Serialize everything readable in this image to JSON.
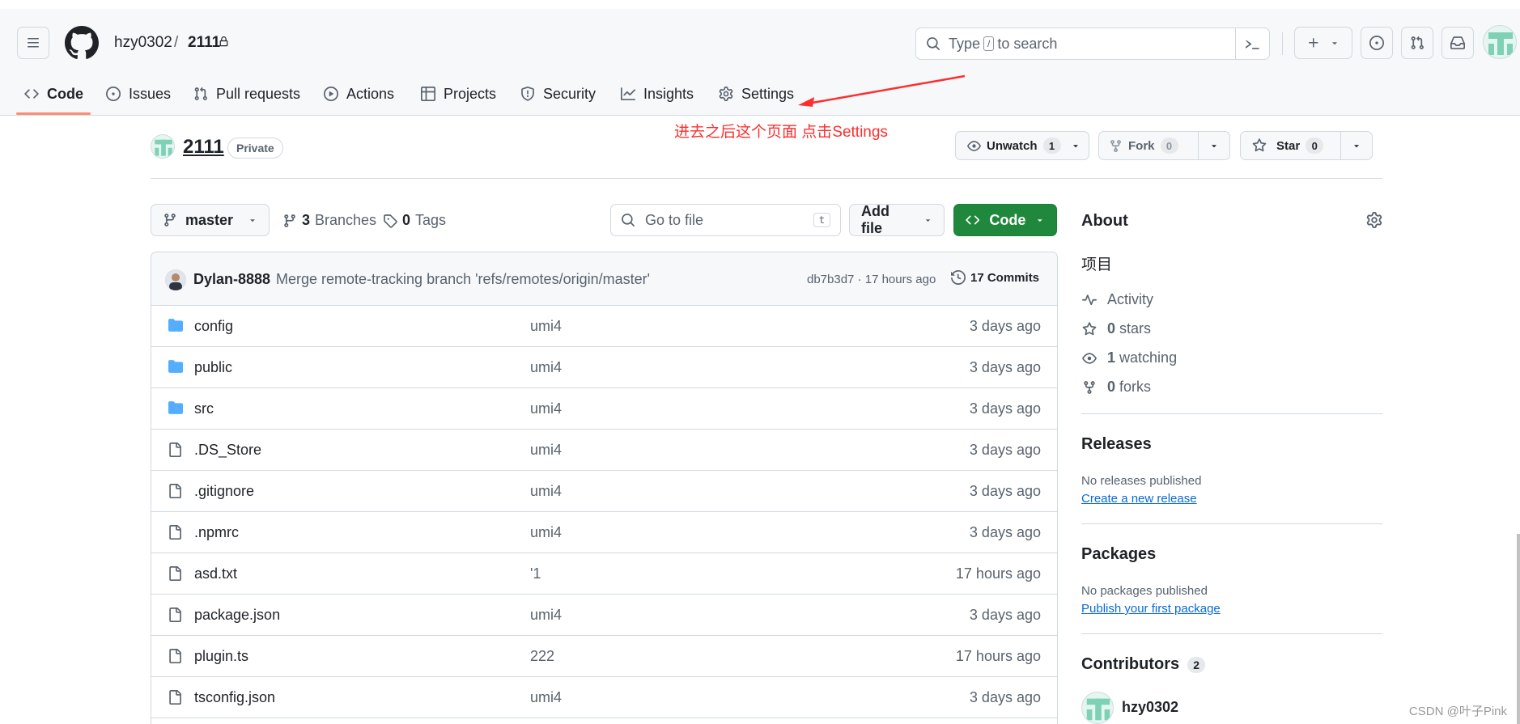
{
  "header": {
    "owner": "hzy0302",
    "separator": "/",
    "repo": "2111",
    "search_placeholder_pre": "Type",
    "search_key": "/",
    "search_placeholder_post": "to search"
  },
  "tabs": [
    {
      "label": "Code",
      "icon": "code-icon"
    },
    {
      "label": "Issues",
      "icon": "issue-icon"
    },
    {
      "label": "Pull requests",
      "icon": "pull-request-icon"
    },
    {
      "label": "Actions",
      "icon": "play-icon"
    },
    {
      "label": "Projects",
      "icon": "table-icon"
    },
    {
      "label": "Security",
      "icon": "shield-icon"
    },
    {
      "label": "Insights",
      "icon": "graph-icon"
    },
    {
      "label": "Settings",
      "icon": "gear-icon"
    }
  ],
  "annotation": "进去之后这个页面 点击Settings",
  "repo_head": {
    "name": "2111",
    "visibility": "Private",
    "unwatch_label": "Unwatch",
    "unwatch_count": "1",
    "fork_label": "Fork",
    "fork_count": "0",
    "star_label": "Star",
    "star_count": "0"
  },
  "toolbar": {
    "branch": "master",
    "branches_count": "3",
    "branches_label": "Branches",
    "tags_count": "0",
    "tags_label": "Tags",
    "goto_placeholder": "Go to file",
    "goto_key": "t",
    "add_file": "Add file",
    "code": "Code"
  },
  "latest_commit": {
    "author": "Dylan-8888",
    "message": "Merge remote-tracking branch 'refs/remotes/origin/master'",
    "sha_time": "db7b3d7 · 17 hours ago",
    "commits": "17 Commits"
  },
  "files": [
    {
      "name": "config",
      "type": "dir",
      "message": "umi4",
      "date": "3 days ago"
    },
    {
      "name": "public",
      "type": "dir",
      "message": "umi4",
      "date": "3 days ago"
    },
    {
      "name": "src",
      "type": "dir",
      "message": "umi4",
      "date": "3 days ago"
    },
    {
      "name": ".DS_Store",
      "type": "file",
      "message": "umi4",
      "date": "3 days ago"
    },
    {
      "name": ".gitignore",
      "type": "file",
      "message": "umi4",
      "date": "3 days ago"
    },
    {
      "name": ".npmrc",
      "type": "file",
      "message": "umi4",
      "date": "3 days ago"
    },
    {
      "name": "asd.txt",
      "type": "file",
      "message": "'1",
      "date": "17 hours ago"
    },
    {
      "name": "package.json",
      "type": "file",
      "message": "umi4",
      "date": "3 days ago"
    },
    {
      "name": "plugin.ts",
      "type": "file",
      "message": "222",
      "date": "17 hours ago"
    },
    {
      "name": "tsconfig.json",
      "type": "file",
      "message": "umi4",
      "date": "3 days ago"
    }
  ],
  "about": {
    "title": "About",
    "description": "项目",
    "activity": "Activity",
    "stars_count": "0",
    "stars_label": "stars",
    "watching_count": "1",
    "watching_label": "watching",
    "forks_count": "0",
    "forks_label": "forks"
  },
  "releases": {
    "title": "Releases",
    "none": "No releases published",
    "link": "Create a new release"
  },
  "packages": {
    "title": "Packages",
    "none": "No packages published",
    "link": "Publish your first package"
  },
  "contributors": {
    "title": "Contributors",
    "count": "2",
    "first": "hzy0302"
  },
  "watermark": "CSDN @叶子Pink",
  "colors": {
    "accent_green": "#1f883d",
    "link_blue": "#0969da",
    "folder_blue": "#54aeff",
    "annotation_red": "#ff2d2d",
    "tab_underline": "#fd8c73"
  }
}
